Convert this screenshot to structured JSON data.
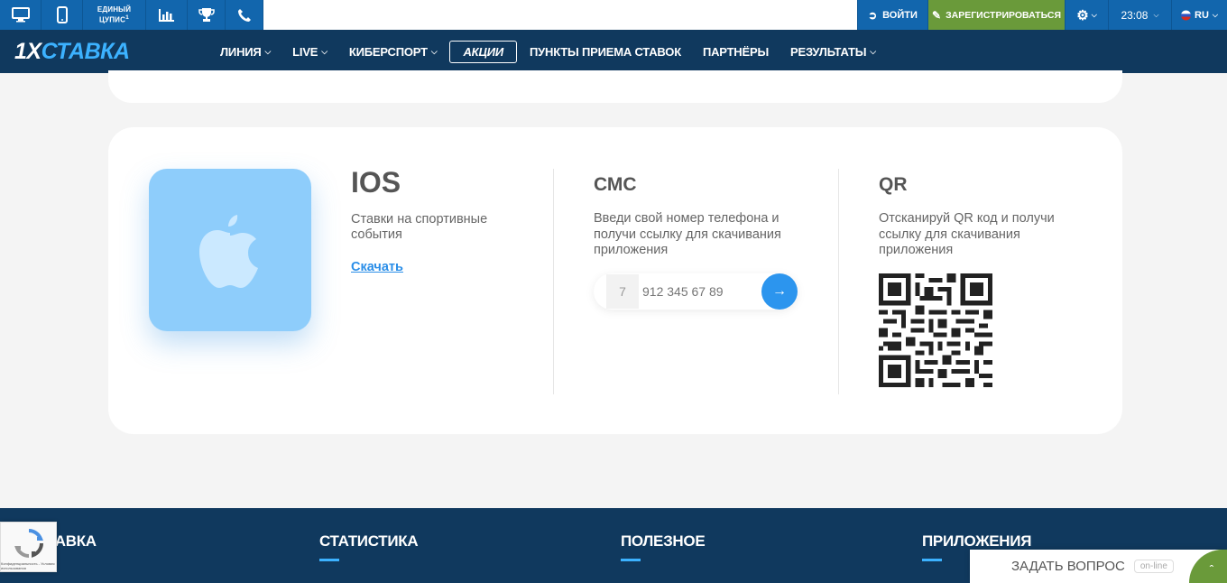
{
  "topbar": {
    "unified_cupis_line1": "ЕДИНЫЙ",
    "unified_cupis_line2": "ЦУПИС",
    "unified_cupis_sup": "1",
    "login_label": "ВОЙТИ",
    "register_label": "ЗАРЕГИСТРИРОВАТЬСЯ",
    "time": "23:08",
    "language": "RU",
    "icons": [
      "desktop-icon",
      "mobile-icon",
      "statistics-icon",
      "trophy-icon",
      "phone-icon",
      "gear-icon",
      "flag-ru-icon"
    ]
  },
  "nav": {
    "logo_prefix": "1X",
    "logo_rest": "СТАВКА",
    "items": [
      {
        "label": "ЛИНИЯ",
        "dropdown": true
      },
      {
        "label": "LIVE",
        "dropdown": true
      },
      {
        "label": "КИБЕРСПОРТ",
        "dropdown": true
      },
      {
        "label": "АКЦИИ",
        "dropdown": false
      },
      {
        "label": "ПУНКТЫ ПРИЕМА СТАВОК",
        "dropdown": false
      },
      {
        "label": "ПАРТНЁРЫ",
        "dropdown": false
      },
      {
        "label": "РЕЗУЛЬТАТЫ",
        "dropdown": true
      }
    ]
  },
  "ios": {
    "title": "IOS",
    "description": "Ставки на спортивные события",
    "download_label": "Скачать"
  },
  "sms": {
    "title": "СМС",
    "description": "Введи свой номер телефона и получи ссылку для скачивания приложения",
    "country_code": "7",
    "phone_placeholder": "912 345 67 89"
  },
  "qr": {
    "title": "QR",
    "description": "Отсканируй QR код и получи ссылку для скачивания приложения"
  },
  "footer": {
    "columns": [
      "1XСТАВКА",
      "СТАТИСТИКА",
      "ПОЛЕЗНОЕ",
      "ПРИЛОЖЕНИЯ"
    ]
  },
  "recaptcha": {
    "text": "Конфиденциальность - Условия использования"
  },
  "chat": {
    "label": "ЗАДАТЬ ВОПРОС",
    "status": "on-line"
  },
  "colors": {
    "brand_blue": "#1266ad",
    "nav_dark": "#10395e",
    "accent_green": "#6a9a3a",
    "accent_light_blue": "#3cb2ff",
    "ios_tile": "#8ecdfb",
    "action_blue": "#2c95ee"
  }
}
